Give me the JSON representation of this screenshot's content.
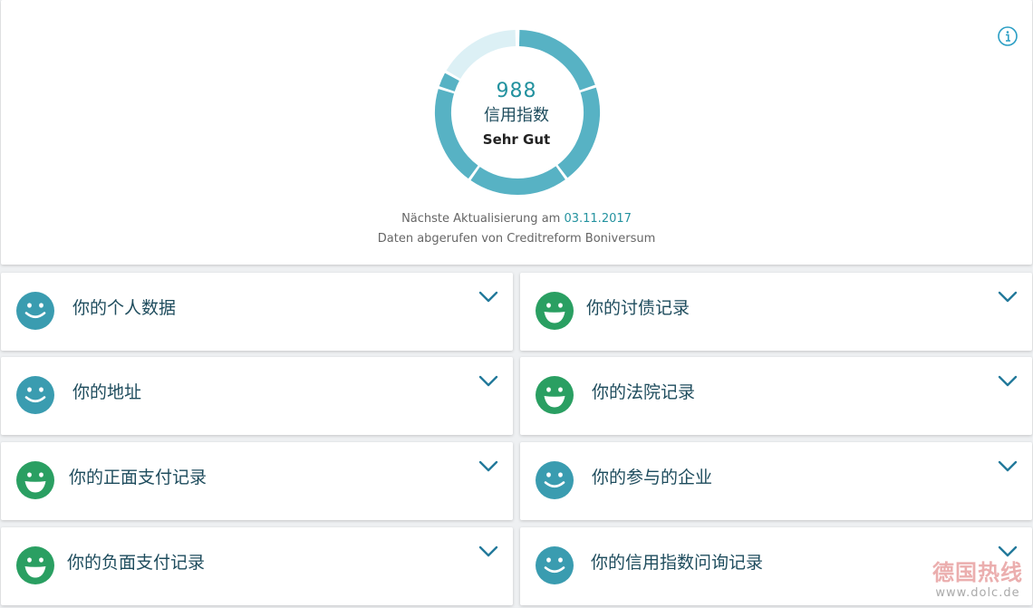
{
  "score": {
    "value": "988",
    "label": "信用指数",
    "rating": "Sehr Gut",
    "update_prefix": "Nächste Aktualisierung am ",
    "update_date": "03.11.2017",
    "source": "Daten abgerufen von Creditreform Boniversum"
  },
  "colors": {
    "teal": "#3a9cb0",
    "green": "#2a9f62",
    "gauge_fill": "#57b2c4",
    "gauge_empty": "#dcf0f5"
  },
  "sections": {
    "left": [
      {
        "title": "你的个人数据",
        "status": "teal"
      },
      {
        "title": "你的地址",
        "status": "teal"
      },
      {
        "title": "你的正面支付记录",
        "status": "green"
      },
      {
        "title": "你的负面支付记录",
        "status": "green"
      }
    ],
    "right": [
      {
        "title": "你的讨债记录",
        "status": "green"
      },
      {
        "title": "你的法院记录",
        "status": "green"
      },
      {
        "title": "你的参与的企业",
        "status": "teal"
      },
      {
        "title": "你的信用指数问询记录",
        "status": "teal"
      }
    ]
  },
  "watermark": {
    "main": "德国热线",
    "sub": "www.dolc.de"
  },
  "icons": {
    "info": "info-circle-icon",
    "expand": "chevron-down-icon",
    "status": "smiley-face-icon"
  }
}
